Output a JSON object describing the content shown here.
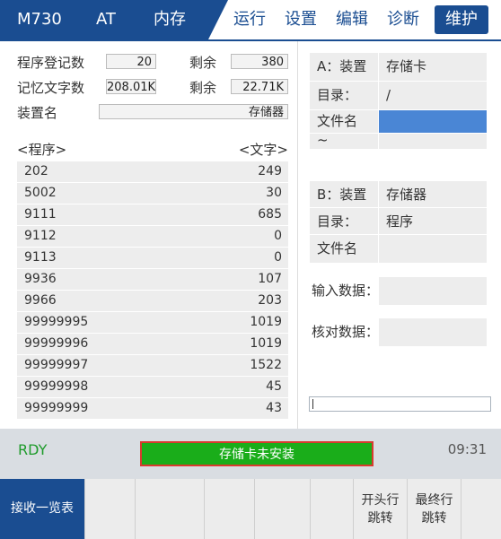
{
  "header": {
    "machine": "M730",
    "mode": "AT",
    "memory": "内存",
    "menu": [
      "运行",
      "设置",
      "编辑",
      "诊断"
    ],
    "active_menu": "维护"
  },
  "memory_info": {
    "prog_count_label": "程序登记数",
    "prog_count": "20",
    "remain_label_1": "剩余",
    "prog_remain": "380",
    "char_count_label": "记忆文字数",
    "char_count": "208.01K",
    "remain_label_2": "剩余",
    "char_remain": "22.71K",
    "device_name_label": "装置名",
    "device_name": "存储器"
  },
  "programs": {
    "col_program": "<程序>",
    "col_chars": "<文字>",
    "rows": [
      {
        "name": "202",
        "chars": "249"
      },
      {
        "name": "5002",
        "chars": "30"
      },
      {
        "name": "9111",
        "chars": "685"
      },
      {
        "name": "9112",
        "chars": "0"
      },
      {
        "name": "9113",
        "chars": "0"
      },
      {
        "name": "9936",
        "chars": "107"
      },
      {
        "name": "9966",
        "chars": "203"
      },
      {
        "name": "99999995",
        "chars": "1019"
      },
      {
        "name": "99999996",
        "chars": "1019"
      },
      {
        "name": "99999997",
        "chars": "1522"
      },
      {
        "name": "99999998",
        "chars": "45"
      },
      {
        "name": "99999999",
        "chars": "43"
      }
    ]
  },
  "panel_a": {
    "device_label": "A：装置",
    "device_value": "存储卡",
    "dir_label": "目录：",
    "dir_value": "/",
    "file_label": "文件名",
    "tilde": "~"
  },
  "panel_b": {
    "device_label": "B：装置",
    "device_value": "存储器",
    "dir_label": "目录：",
    "dir_value": "程序",
    "file_label": "文件名"
  },
  "input_label": "输入数据：",
  "verify_label": "核对数据：",
  "status": {
    "rdy": "RDY",
    "message": "存储卡未安装",
    "time": "09:31"
  },
  "softkeys": {
    "receive_list": "接收一览表",
    "head_jump_1": "开头行",
    "head_jump_2": "跳转",
    "end_jump_1": "最终行",
    "end_jump_2": "跳转"
  },
  "colors": {
    "header_blue": "#1a4d91",
    "selected_blue": "#4a86d5",
    "rdy_green": "#1e9b2b",
    "message_green": "#1aad1a",
    "message_border": "#d83a2e"
  }
}
